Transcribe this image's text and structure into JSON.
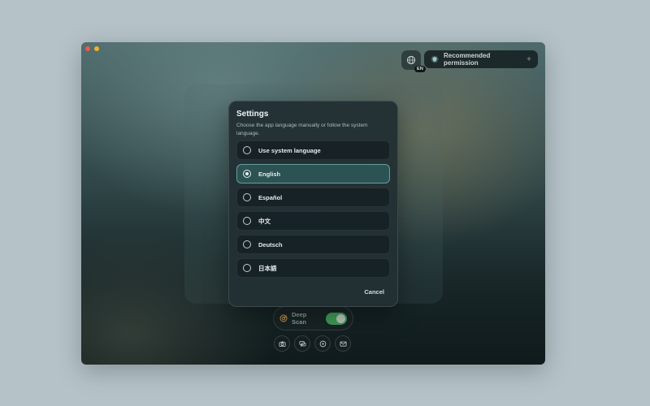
{
  "window": {
    "traffic_lights": [
      "close",
      "minimize"
    ]
  },
  "header": {
    "language_badge": "EN",
    "permission_button_label": "Recommended permission",
    "permission_button_plus": "+"
  },
  "dialog": {
    "title": "Settings",
    "description": "Choose the app language manually or follow the system language.",
    "options": [
      {
        "label": "Use system language",
        "selected": false
      },
      {
        "label": "English",
        "selected": true
      },
      {
        "label": "Español",
        "selected": false
      },
      {
        "label": "中文",
        "selected": false
      },
      {
        "label": "Deutsch",
        "selected": false
      },
      {
        "label": "日本語",
        "selected": false
      }
    ],
    "cancel_label": "Cancel"
  },
  "scan": {
    "label": "Deep Scan",
    "enabled": true
  },
  "tools": [
    "camera-icon",
    "chat-icon",
    "target-icon",
    "mail-icon"
  ],
  "colors": {
    "toggle_on": "#3e9a55",
    "selected_border": "#96dcd2",
    "close": "#f2564b",
    "minimize": "#f0b22a"
  }
}
